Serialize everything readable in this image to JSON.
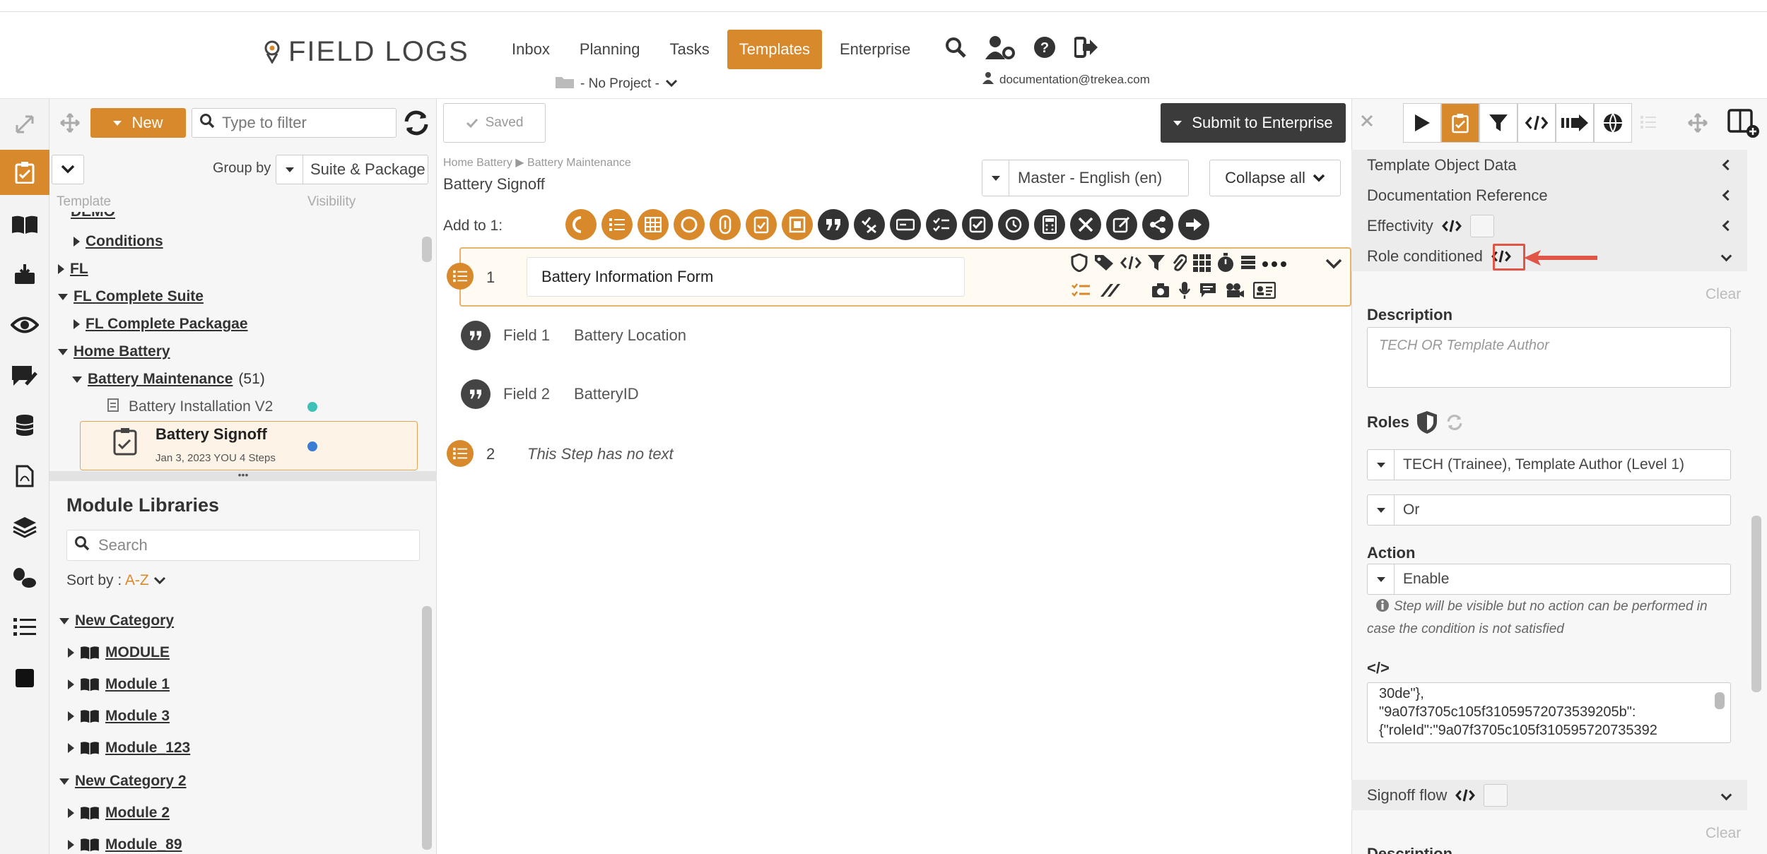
{
  "app": {
    "brand": "FIELD LOGS",
    "accent": "#d8892b"
  },
  "nav": {
    "items": [
      "Inbox",
      "Planning",
      "Tasks",
      "Templates",
      "Enterprise"
    ],
    "active": "Templates"
  },
  "project": {
    "label": "- No Project -"
  },
  "user": {
    "email": "documentation@trekea.com"
  },
  "left": {
    "new_label": "New",
    "filter_placeholder": "Type to filter",
    "group_by_label": "Group by",
    "group_by_value": "Suite & Package",
    "col_template": "Template",
    "col_visibility": "Visibility",
    "tree": [
      {
        "label": "DEMO"
      },
      {
        "label": "Conditions"
      },
      {
        "label": "FL"
      },
      {
        "label": "FL Complete Suite"
      },
      {
        "label": "FL Complete Packagae"
      },
      {
        "label": "Home Battery"
      },
      {
        "label": "Battery Maintenance",
        "count": "(51)"
      },
      {
        "label": "Battery Installation V2",
        "dot": "#3cc0b8"
      },
      {
        "label": "Battery Signoff",
        "meta": "Jan 3, 2023 YOU 4 Steps",
        "dot": "#3a7bd5"
      }
    ],
    "modules_title": "Module Libraries",
    "modules_search_placeholder": "Search",
    "sort_by_label": "Sort by :",
    "sort_by_value": "A-Z",
    "modules": [
      {
        "label": "New Category"
      },
      {
        "label": "MODULE"
      },
      {
        "label": "Module 1"
      },
      {
        "label": "Module 3"
      },
      {
        "label": "Module_123"
      },
      {
        "label": "New Category 2"
      },
      {
        "label": "Module 2"
      },
      {
        "label": "Module_89"
      }
    ]
  },
  "center": {
    "saved_label": "Saved",
    "submit_label": "Submit to Enterprise",
    "breadcrumb": [
      "Home Battery",
      "Battery Maintenance"
    ],
    "title": "Battery Signoff",
    "language": "Master - English (en)",
    "collapse_label": "Collapse all",
    "add_to_label": "Add to 1:",
    "steps": [
      {
        "num": "1",
        "text": "Battery Information Form"
      },
      {
        "num": "2",
        "text": "This Step has no text"
      }
    ],
    "fields": [
      {
        "label": "Field 1",
        "value": "Battery Location"
      },
      {
        "label": "Field 2",
        "value": "BatteryID"
      }
    ]
  },
  "right": {
    "sections": [
      "Template Object Data",
      "Documentation Reference",
      "Effectivity",
      "Role conditioned"
    ],
    "clear_label": "Clear",
    "description_label": "Description",
    "description_placeholder": "TECH OR Template Author",
    "roles_label": "Roles",
    "roles_value": "TECH (Trainee), Template Author (Level 1)",
    "operator_value": "Or",
    "action_label": "Action",
    "action_value": "Enable",
    "action_hint": "Step will be visible but no action can be performed in case the condition is not satisfied",
    "code_label": "</>",
    "code_lines": [
      "30de\"},",
      "\"9a07f3705c105f31059572073539205b\":",
      "{\"roleId\":\"9a07f3705c105f310595720735392"
    ],
    "signoff_label": "Signoff flow",
    "description2_label": "Description"
  }
}
